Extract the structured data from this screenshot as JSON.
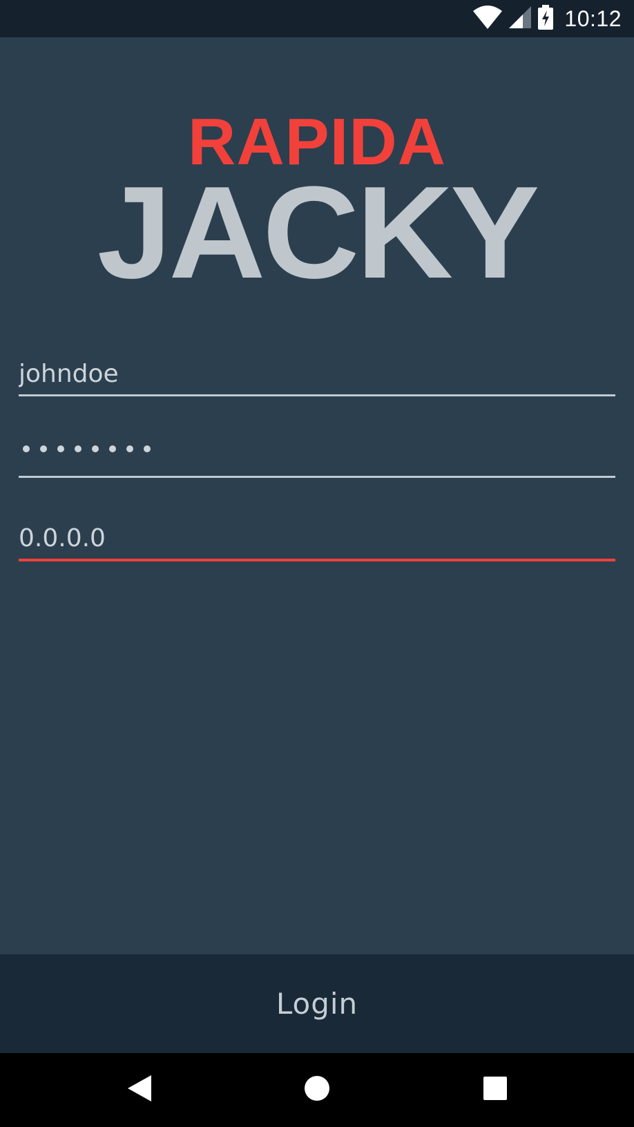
{
  "status_bar": {
    "time": "10:12",
    "icons": [
      "wifi-icon",
      "cell-signal-icon",
      "battery-charging-icon"
    ]
  },
  "brand": {
    "line1": "RAPIDA",
    "line2": "JACKY"
  },
  "form": {
    "username_value": "johndoe",
    "password_length": 8,
    "server_value": "0.0.0.0"
  },
  "login": {
    "label": "Login"
  },
  "colors": {
    "background": "#2b3f4f",
    "accent": "#f2413a",
    "brand_secondary": "#bfc7cc",
    "login_bar": "#1a2938",
    "status_bar": "#15212d"
  },
  "nav": {
    "buttons": [
      "back-icon",
      "home-icon",
      "recents-icon"
    ]
  }
}
